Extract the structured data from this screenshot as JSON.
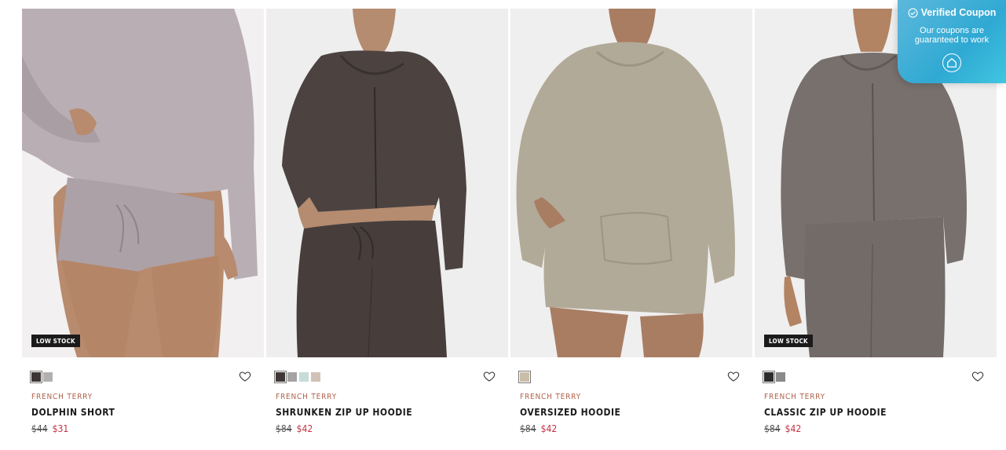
{
  "products": [
    {
      "badge": "LOW STOCK",
      "fabric": "FRENCH TERRY",
      "name": "DOLPHIN SHORT",
      "old_price": "$44",
      "new_price": "$31",
      "swatches": [
        "#3d3636",
        "#b3b0b0"
      ],
      "garment_color": "#b6aab0",
      "photo_bg": "#f2f0f0"
    },
    {
      "badge": "",
      "fabric": "FRENCH TERRY",
      "name": "SHRUNKEN ZIP UP HOODIE",
      "old_price": "$84",
      "new_price": "$42",
      "swatches": [
        "#3f3836",
        "#a6a3a5",
        "#c7dbd9",
        "#d2c2b5"
      ],
      "garment_color": "#4c4341",
      "photo_bg": "#eeeeee"
    },
    {
      "badge": "",
      "fabric": "FRENCH TERRY",
      "name": "OVERSIZED HOODIE",
      "old_price": "$84",
      "new_price": "$42",
      "swatches": [
        "#c9bda9"
      ],
      "garment_color": "#b2aa98",
      "photo_bg": "#efefef"
    },
    {
      "badge": "LOW STOCK",
      "fabric": "FRENCH TERRY",
      "name": "CLASSIC ZIP UP HOODIE",
      "old_price": "$84",
      "new_price": "$42",
      "swatches": [
        "#2d2d2d",
        "#8a8a8a"
      ],
      "garment_color": "#77706d",
      "photo_bg": "#efefef"
    }
  ],
  "coupon": {
    "title": "Verified Coupon",
    "subtitle_line1": "Our coupons are",
    "subtitle_line2": "guaranteed to work"
  },
  "icons": {
    "wishlist": "heart-outline-icon",
    "verified": "check-circle-icon",
    "coupon_action": "house-tag-icon"
  }
}
